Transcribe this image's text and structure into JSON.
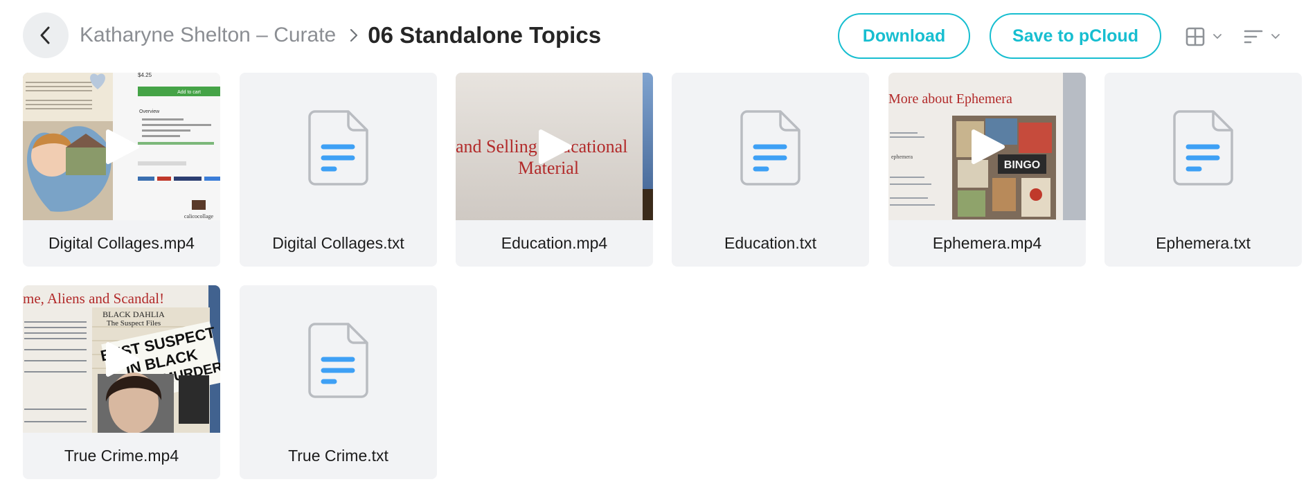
{
  "header": {
    "parent_folder": "Katharyne Shelton – Curate",
    "current_folder": "06 Standalone Topics",
    "download_label": "Download",
    "save_label": "Save to pCloud"
  },
  "colors": {
    "accent": "#17bed0",
    "doc_lines": "#3ea0f5",
    "tile_bg": "#f2f3f5"
  },
  "files": [
    {
      "name": "Digital Collages.mp4",
      "type": "video",
      "thumb": "collage",
      "thumb_text": {
        "price": "$4.25",
        "cart": "Add to cart",
        "overview": "Overview",
        "shop": "calicocollage"
      }
    },
    {
      "name": "Digital Collages.txt",
      "type": "text"
    },
    {
      "name": "Education.mp4",
      "type": "video",
      "thumb": "education",
      "thumb_text": {
        "line1": "and Selling Educational",
        "line2": "Material"
      }
    },
    {
      "name": "Education.txt",
      "type": "text"
    },
    {
      "name": "Ephemera.mp4",
      "type": "video",
      "thumb": "ephemera",
      "thumb_text": {
        "title": "More about Ephemera",
        "label": "ephemera",
        "bingo": "BINGO"
      }
    },
    {
      "name": "Ephemera.txt",
      "type": "text"
    },
    {
      "name": "True Crime.mp4",
      "type": "video",
      "thumb": "crime",
      "thumb_text": {
        "title": "me, Aliens and Scandal!",
        "sub1": "BLACK DAHLIA",
        "sub2": "The Suspect Files",
        "headline1": "BEST SUSPECT",
        "headline2": "IN BLACK",
        "headline3": "DAHLIA MURDER"
      }
    },
    {
      "name": "True Crime.txt",
      "type": "text"
    }
  ]
}
